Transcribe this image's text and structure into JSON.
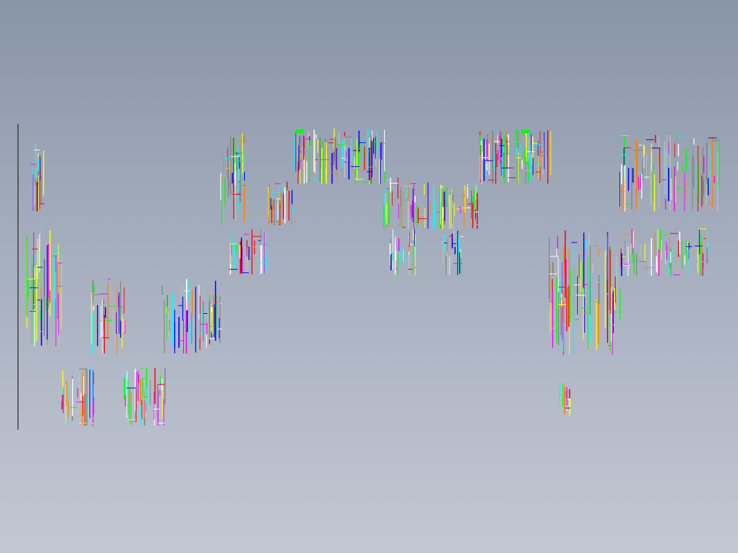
{
  "viewport": {
    "background_top": "#8895a8",
    "background_bottom": "#c3c7d3"
  },
  "drawing": {
    "line_colors": [
      "#ff0000",
      "#00ffff",
      "#ff00ff",
      "#ffff00",
      "#00ff00",
      "#0000ff",
      "#ffffff",
      "#c0c0c0",
      "#ff8000",
      "#808080"
    ],
    "frame_color": "#222222"
  }
}
